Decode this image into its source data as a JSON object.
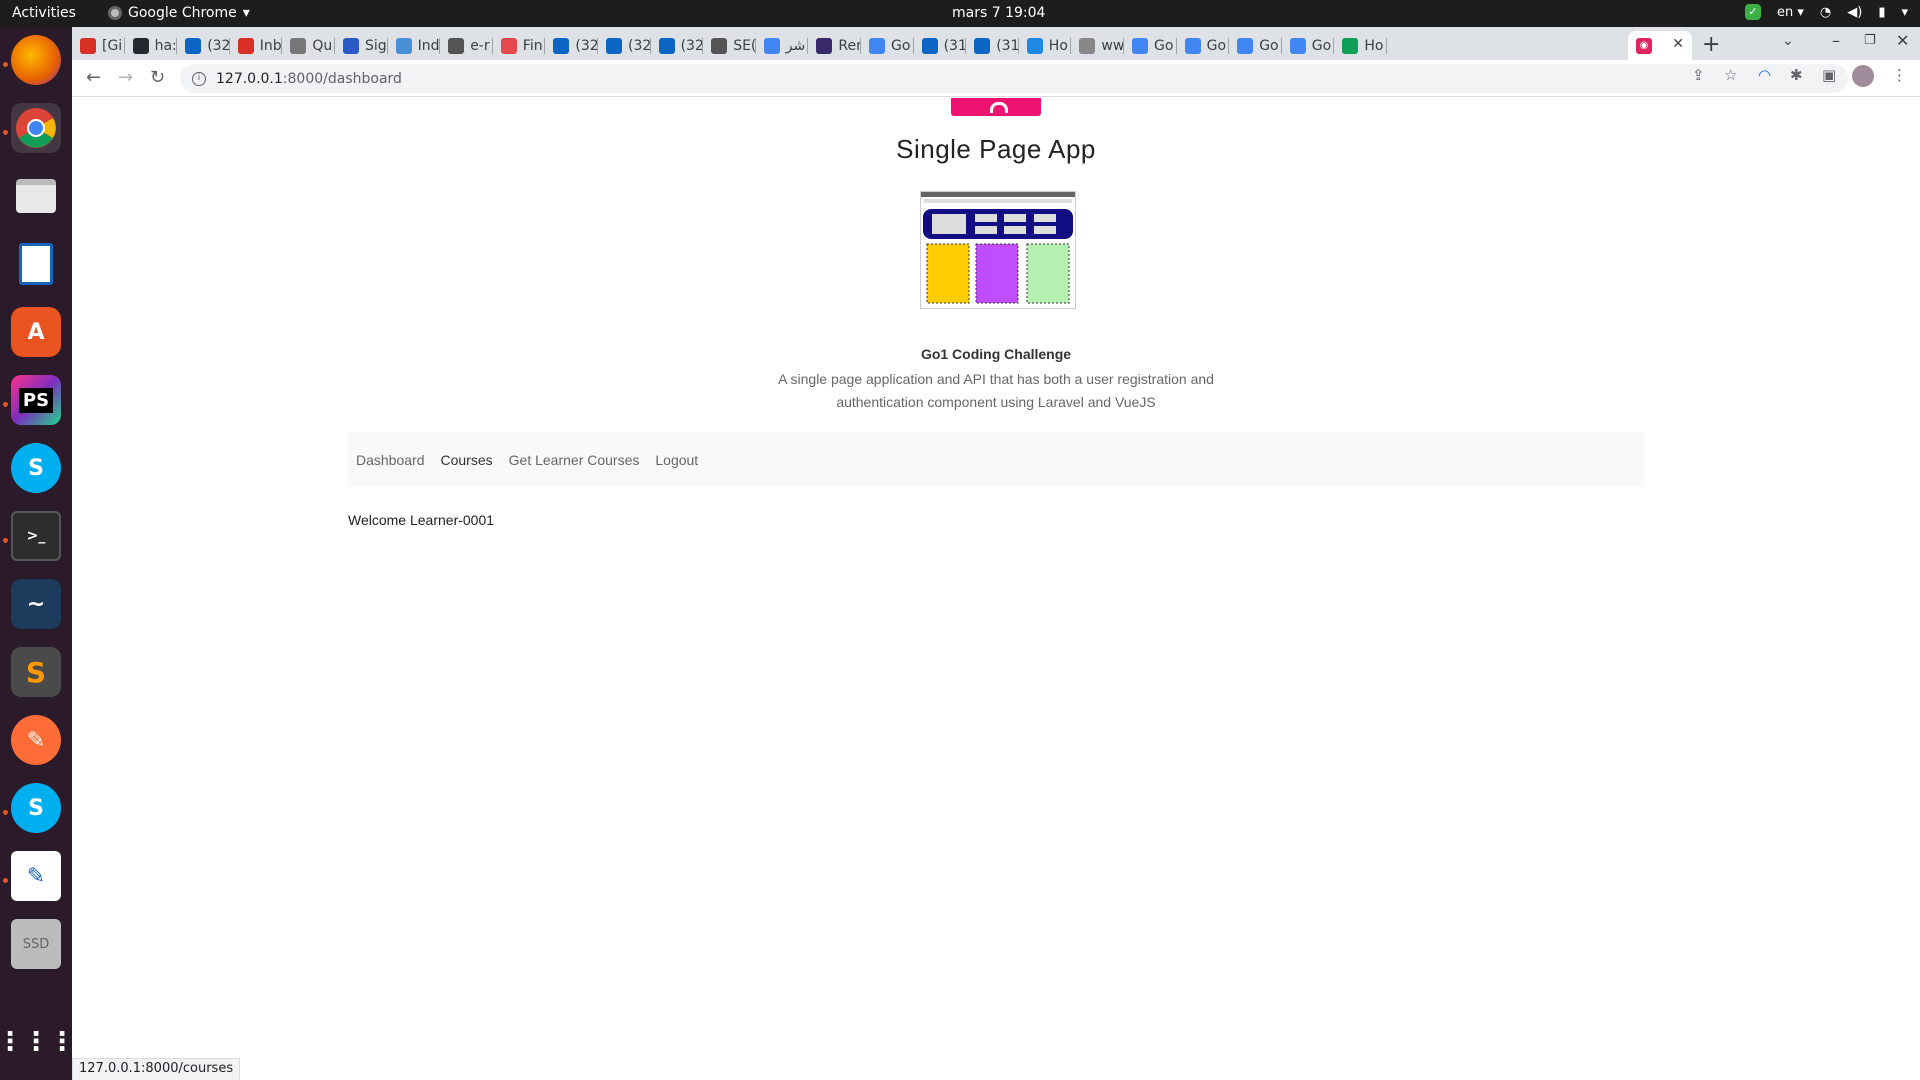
{
  "os": {
    "activities": "Activities",
    "app_name": "Google Chrome",
    "clock": "mars 7  19:04",
    "lang": "en"
  },
  "tabs": [
    {
      "label": "[Gi",
      "icon": "gmail-icon",
      "color": "#d93025"
    },
    {
      "label": "ha:",
      "icon": "github-icon",
      "color": "#24292f"
    },
    {
      "label": "(32",
      "icon": "linkedin-icon",
      "color": "#0a66c2"
    },
    {
      "label": "Inb",
      "icon": "gmail-icon",
      "color": "#d93025"
    },
    {
      "label": "Qu",
      "icon": "quora-icon",
      "color": "#777"
    },
    {
      "label": "Sig",
      "icon": "sign-icon",
      "color": "#2b59c3"
    },
    {
      "label": "Ind",
      "icon": "globe-icon",
      "color": "#4a90d9"
    },
    {
      "label": "e-r",
      "icon": "web-icon",
      "color": "#555"
    },
    {
      "label": "Fin",
      "icon": "fin-icon",
      "color": "#e5484d"
    },
    {
      "label": "(32",
      "icon": "linkedin-icon",
      "color": "#0a66c2"
    },
    {
      "label": "(32",
      "icon": "linkedin-icon",
      "color": "#0a66c2"
    },
    {
      "label": "(32",
      "icon": "linkedin-icon",
      "color": "#0a66c2"
    },
    {
      "label": "SE(",
      "icon": "info-icon",
      "color": "#555"
    },
    {
      "label": "شر",
      "icon": "google-icon",
      "color": "#4285f4"
    },
    {
      "label": "Rer",
      "icon": "remote-icon",
      "color": "#3b2a6b"
    },
    {
      "label": "Go",
      "icon": "translate-icon",
      "color": "#4285f4"
    },
    {
      "label": "(31",
      "icon": "linkedin-icon",
      "color": "#0a66c2"
    },
    {
      "label": "(31",
      "icon": "linkedin-icon",
      "color": "#0a66c2"
    },
    {
      "label": "Ho",
      "icon": "mailbox-icon",
      "color": "#1e88e5"
    },
    {
      "label": "ww",
      "icon": "page-icon",
      "color": "#888"
    },
    {
      "label": "Go",
      "icon": "translate-icon",
      "color": "#4285f4"
    },
    {
      "label": "Go",
      "icon": "translate-icon",
      "color": "#4285f4"
    },
    {
      "label": "Go",
      "icon": "translate-icon",
      "color": "#4285f4"
    },
    {
      "label": "Go",
      "icon": "translate-icon",
      "color": "#4285f4"
    },
    {
      "label": "Ho",
      "icon": "drive-icon",
      "color": "#0f9d58"
    }
  ],
  "active_tab": {
    "icon": "laravel-icon",
    "color": "#e0245e"
  },
  "address": {
    "host": "127.0.0.1",
    "path": ":8000/dashboard"
  },
  "page": {
    "title": "Single Page App",
    "subtitle": "Go1 Coding Challenge",
    "description": "A single page application and API that has both a user registration and authentication component using Laravel and VueJS",
    "nav": [
      "Dashboard",
      "Courses",
      "Get Learner Courses",
      "Logout"
    ],
    "welcome": "Welcome Learner-0001",
    "brand_color": "#f01472"
  },
  "status_url": "127.0.0.1:8000/courses"
}
